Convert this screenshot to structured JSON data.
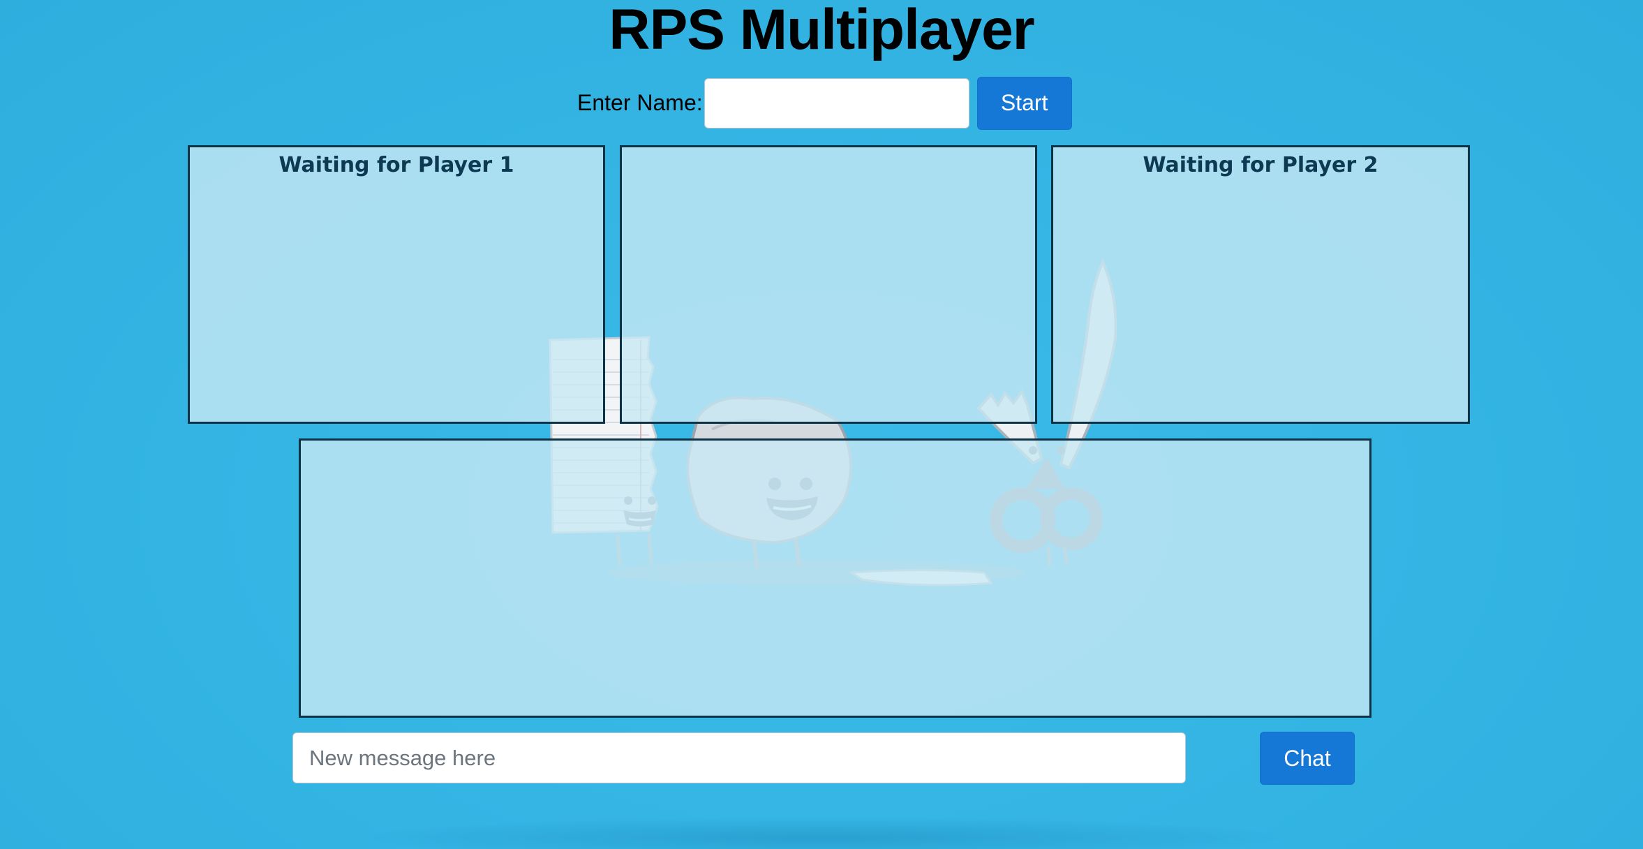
{
  "page": {
    "title": "RPS Multiplayer",
    "background_color": "#33b4e3",
    "accent_color": "#1578d6"
  },
  "name_form": {
    "label": "Enter Name:",
    "input_value": "",
    "input_placeholder": "",
    "start_label": "Start"
  },
  "panels": {
    "player1_title": "Waiting for Player 1",
    "middle_title": "",
    "player2_title": "Waiting for Player 2"
  },
  "chat": {
    "input_placeholder": "New message here",
    "input_value": "",
    "button_label": "Chat"
  },
  "illustration": {
    "characters": [
      "paper-character",
      "rock-character",
      "scissors-character"
    ]
  }
}
